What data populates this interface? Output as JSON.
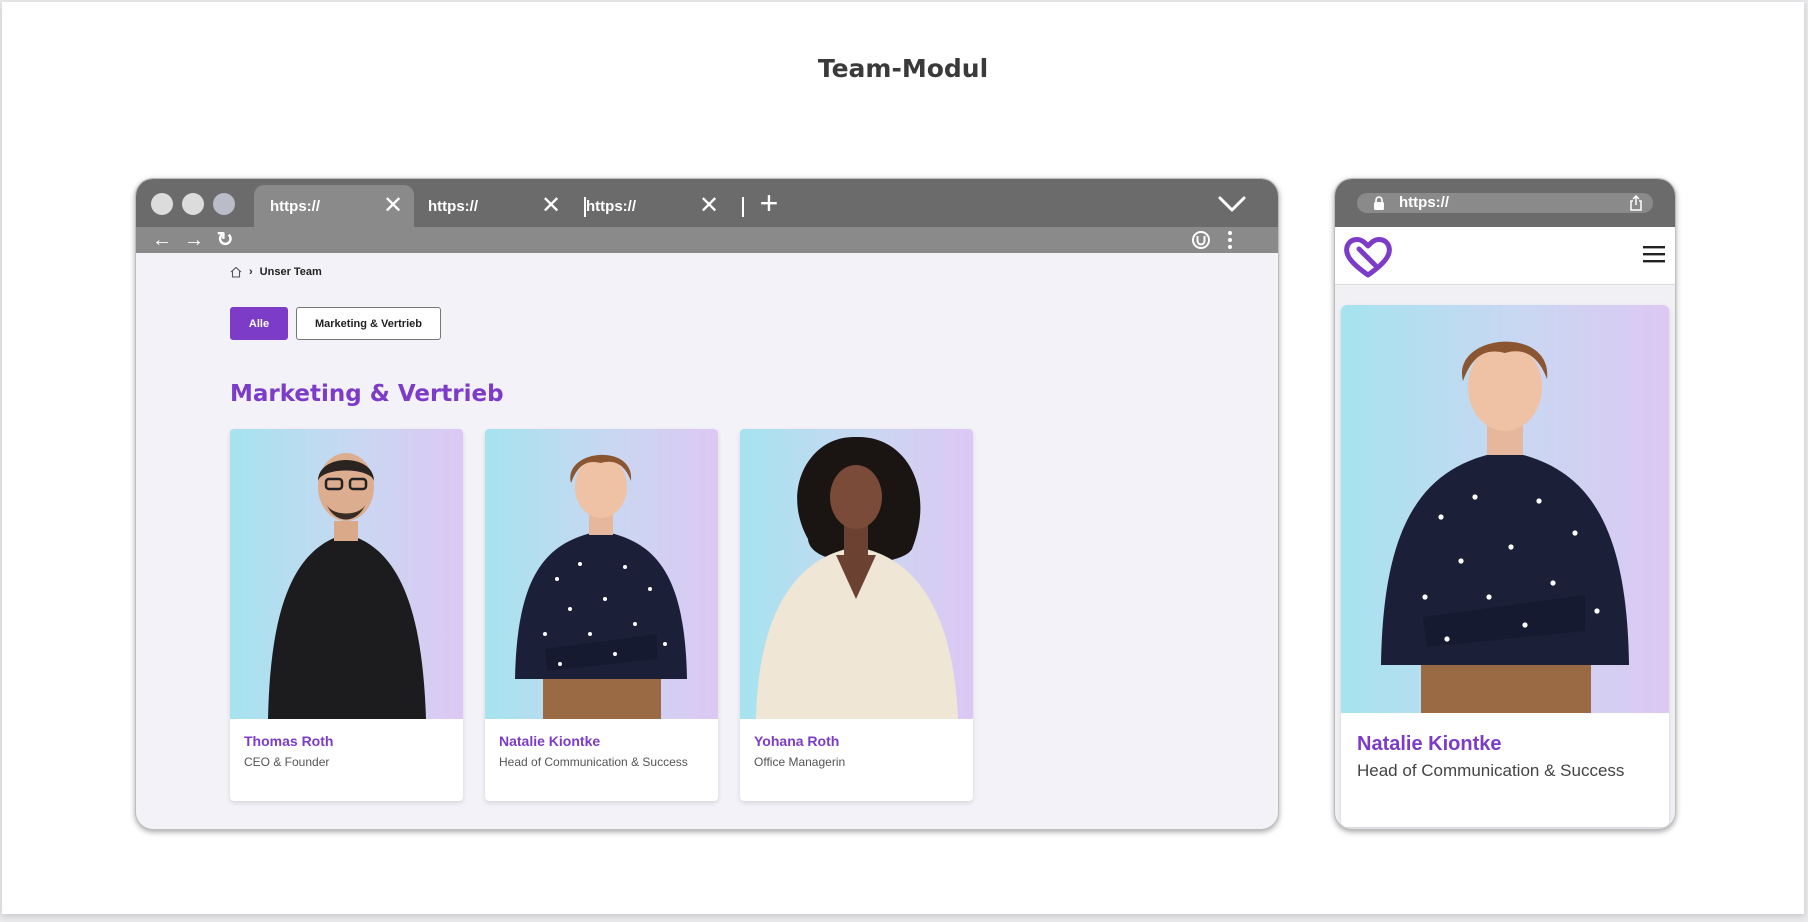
{
  "page": {
    "title": "Team-Modul"
  },
  "browser": {
    "tabs": [
      {
        "label": "https://",
        "active": true
      },
      {
        "label": "https://",
        "active": false
      },
      {
        "label": "https://",
        "active": false
      }
    ]
  },
  "site": {
    "breadcrumb": {
      "current": "Unser Team"
    },
    "filters": [
      {
        "label": "Alle",
        "active": true
      },
      {
        "label": "Marketing & Vertrieb",
        "active": false
      }
    ],
    "section_heading": "Marketing & Vertrieb",
    "members": [
      {
        "name": "Thomas Roth",
        "role": "CEO & Founder"
      },
      {
        "name": "Natalie Kiontke",
        "role": "Head of Communication & Success"
      },
      {
        "name": "Yohana Roth",
        "role": "Office Managerin"
      }
    ]
  },
  "mobile": {
    "url": "https://",
    "member": {
      "name": "Natalie Kiontke",
      "role": "Head of Communication & Success"
    }
  },
  "colors": {
    "accent": "#7c3cc8",
    "chrome_dark": "#6b6b6b",
    "chrome_light": "#8a8a8a",
    "photo_gradient_start": "#a6e3ef",
    "photo_gradient_end": "#ddc8f3"
  }
}
